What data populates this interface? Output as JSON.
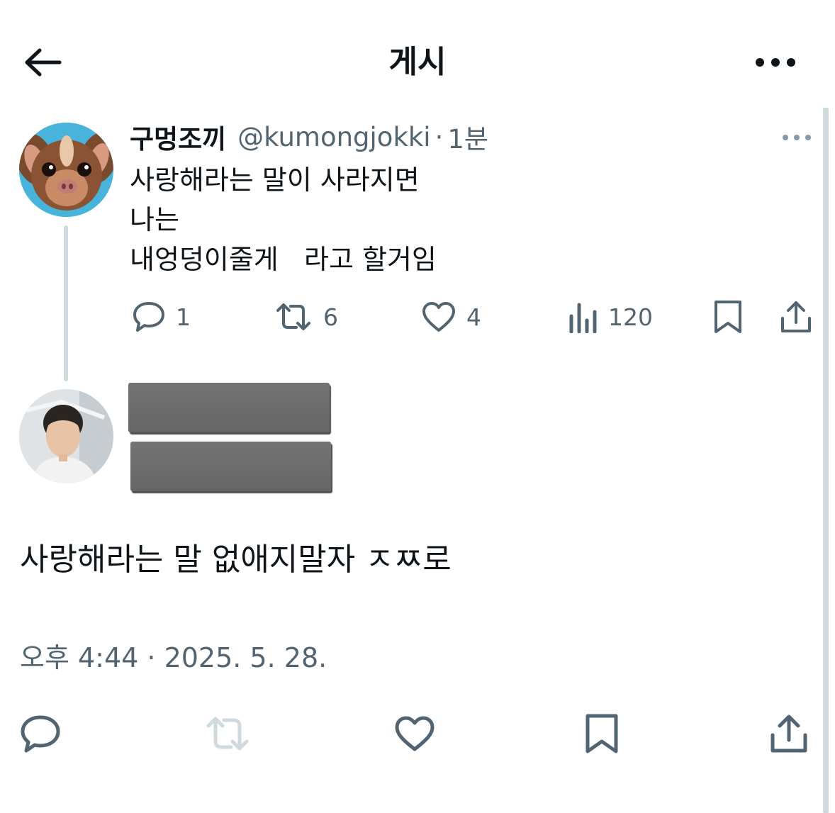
{
  "header": {
    "title": "게시",
    "back_icon": "arrow-left-icon",
    "more_icon": "more-horizontal-icon"
  },
  "tweet": {
    "display_name": "구멍조끼",
    "handle": "@kumongjokki",
    "separator": "·",
    "time": "1분",
    "text": "사랑해라는 말이 사라지면\n나는\n내엉덩이줄게   라고 할거임",
    "actions": {
      "replies": "1",
      "retweets": "6",
      "likes": "4",
      "views": "120"
    }
  },
  "reply": {
    "text": "사랑해라는 말 없애지말자 ㅈㅉ로",
    "timestamp": "오후 4:44 · 2025. 5. 28."
  },
  "colors": {
    "text_primary": "#0f1419",
    "text_secondary": "#536471",
    "divider": "#cfd9de",
    "redaction": "#6e6e6e"
  }
}
